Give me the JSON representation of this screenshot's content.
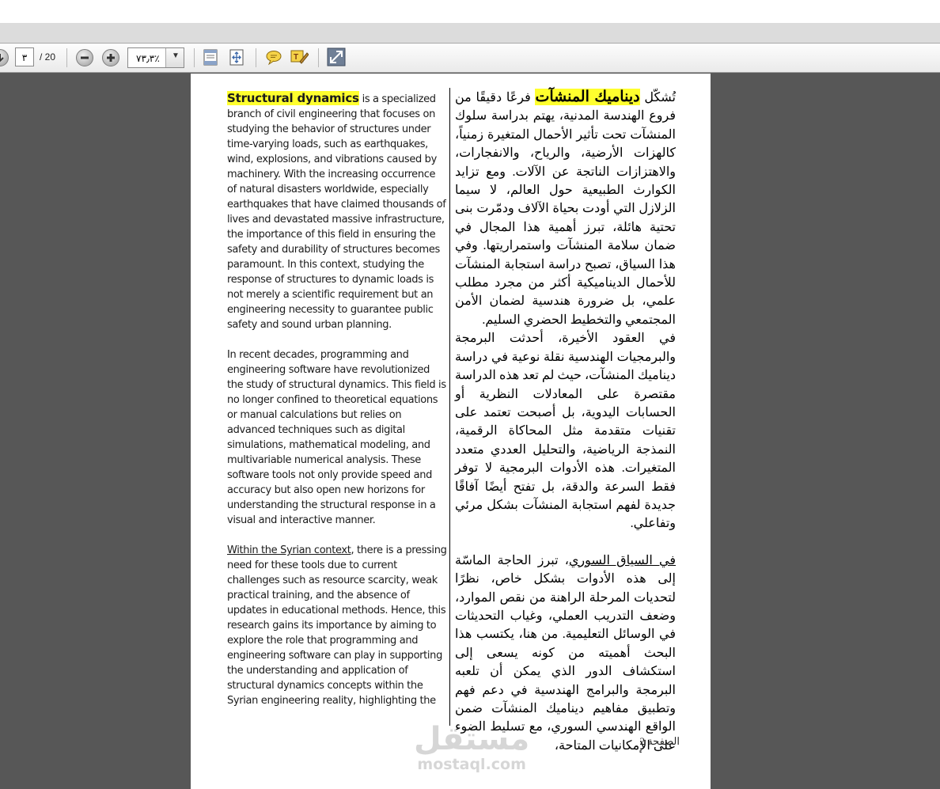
{
  "toolbar": {
    "current_page": "٣",
    "page_count": "/ 20",
    "zoom_value": "٧٣٫٣٪"
  },
  "document": {
    "left": {
      "p1_highlight": "Structural dynamics",
      "p1_rest": " is a specialized branch of civil engineering that focuses on studying the behavior of structures under time-varying loads, such as earthquakes, wind, explosions, and vibrations caused by machinery. With the increasing occurrence of natural disasters worldwide, especially earthquakes that have claimed thousands of lives and devastated massive infrastructure, the importance of this field in ensuring the safety and durability of structures becomes paramount. In this context, studying the response of structures to dynamic loads is not merely a scientific requirement but an engineering necessity to guarantee public safety and sound urban planning.",
      "p2": "In recent decades, programming and engineering software have revolutionized the study of structural dynamics. This field is no longer confined to theoretical equations or manual calculations but relies on advanced techniques such as digital simulations, mathematical modeling, and multivariable numerical analysis. These software tools not only provide speed and accuracy but also open new horizons for understanding the structural response in a visual and interactive manner.",
      "p3_underlined": "Within the Syrian context",
      "p3_rest": ", there is a pressing need for these tools due to current challenges such as resource scarcity, weak practical training, and the absence of updates in educational methods. Hence, this research gains its importance by aiming to explore the role that programming and engineering software can play in supporting the understanding and application of structural dynamics concepts within the Syrian engineering reality, highlighting the"
    },
    "right": {
      "p1_start": "تُشكّل ",
      "p1_highlight": "ديناميك المنشآت",
      "p1_rest": " فرعًا دقيقًا من فروع الهندسة المدنية، يهتم بدراسة سلوك المنشآت تحت تأثير الأحمال المتغيرة زمنياً، كالهزات الأرضية، والرياح، والانفجارات، والاهتزازات الناتجة عن الآلات. ومع تزايد الكوارث الطبيعية حول العالم، لا سيما الزلازل التي أودت بحياة الآلاف ودمّرت بنى تحتية هائلة، تبرز أهمية هذا المجال في ضمان سلامة المنشآت واستمراريتها. وفي هذا السياق، تصبح دراسة استجابة المنشآت للأحمال الديناميكية أكثر من مجرد مطلب علمي، بل ضرورة هندسية لضمان الأمن المجتمعي والتخطيط الحضري السليم.",
      "p2": "في العقود الأخيرة، أحدثت البرمجة والبرمجيات الهندسية نقلة نوعية في دراسة ديناميك المنشآت، حيث لم تعد هذه الدراسة مقتصرة على المعادلات النظرية أو الحسابات اليدوية، بل أصبحت تعتمد على تقنيات متقدمة مثل المحاكاة الرقمية، النمذجة الرياضية، والتحليل العددي متعدد المتغيرات. هذه الأدوات البرمجية لا توفر فقط السرعة والدقة، بل تفتح أيضًا آفاقًا جديدة لفهم استجابة المنشآت بشكل مرئي وتفاعلي.",
      "p3_underlined": "في السياق السوري",
      "p3_rest": "، تبرز الحاجة الماسّة إلى هذه الأدوات بشكل خاص، نظرًا لتحديات المرحلة الراهنة من نقص الموارد، وضعف التدريب العملي، وغياب التحديثات في الوسائل التعليمية. من هنا، يكتسب هذا البحث أهميته من كونه يسعى إلى استكشاف الدور الذي يمكن أن تلعبه البرمجة والبرامج الهندسية في دعم فهم وتطبيق مفاهيم ديناميك المنشآت ضمن الواقع الهندسي السوري، مع تسليط الضوء على الإمكانيات المتاحة،"
    },
    "page_label": "الصفحة 2"
  },
  "watermark": {
    "arabic": "مستقل",
    "latin": "mostaql.com"
  }
}
